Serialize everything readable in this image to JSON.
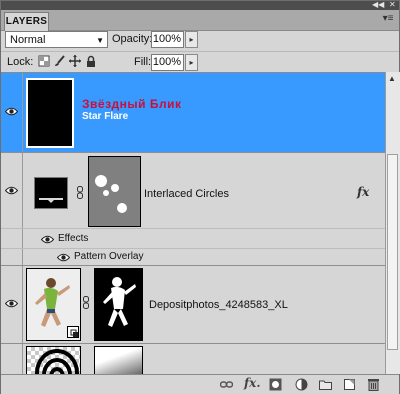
{
  "panel": {
    "tab_label": "LAYERS",
    "collapse_glyph": "◀◀",
    "close_glyph": "✕",
    "menu_glyph": "▾≡"
  },
  "blend": {
    "mode": "Normal",
    "opacity_label": "Opacity:",
    "opacity_value": "100%",
    "stepper_glyph": "▸"
  },
  "lock": {
    "label": "Lock:",
    "icons": [
      "lock-transparent-icon",
      "lock-image-icon",
      "lock-position-icon",
      "lock-all-icon"
    ],
    "fill_label": "Fill:",
    "fill_value": "100%"
  },
  "layers": [
    {
      "name_ru": "Звёздный Блик",
      "name_en": "Star Flare",
      "selected": true,
      "visible": true
    },
    {
      "name": "Interlaced Circles",
      "visible": true,
      "fx": "fx",
      "effects_label": "Effects",
      "effect_items": [
        "Pattern Overlay"
      ]
    },
    {
      "name": "Depositphotos_4248583_XL",
      "visible": true,
      "smart_object": true
    },
    {
      "name": "",
      "visible": false
    }
  ],
  "colors": {
    "selection": "#3899ff",
    "russian_name": "#c8103c"
  },
  "bottom_icons": [
    "link-layers-icon",
    "add-style-icon",
    "add-mask-icon",
    "adjustment-layer-icon",
    "new-group-icon",
    "new-layer-icon",
    "delete-layer-icon"
  ],
  "bottom_fx_label": "fx."
}
